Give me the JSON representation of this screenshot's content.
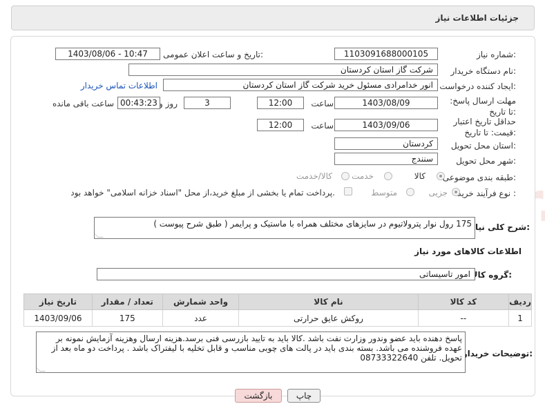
{
  "header": {
    "title": "جزئیات اطلاعات نیاز"
  },
  "form": {
    "need_number": {
      "label": "شماره نیاز:",
      "value": "1103091688000105"
    },
    "announce_datetime": {
      "label": "تاریخ و ساعت اعلان عمومی:",
      "value": "1403/08/06 - 10:47"
    },
    "buyer_org": {
      "label": "نام دستگاه خریدار:",
      "value": "شرکت گاز استان کردستان"
    },
    "requester": {
      "label": "ایجاد کننده درخواست:",
      "value": "انور خدامرادی مسئول خرید  شرکت گاز استان کردستان",
      "contact_link": "اطلاعات تماس خریدار"
    },
    "reply_deadline": {
      "label": "مهلت ارسال پاسخ: تا تاریخ:",
      "date": "1403/08/09",
      "time_label": "ساعت",
      "time": "12:00",
      "days": "3",
      "days_label": "روز و",
      "remaining": "00:43:23",
      "remaining_label": "ساعت باقی مانده"
    },
    "price_validity": {
      "label": "حداقل تاریخ اعتبار قیمت: تا تاریخ:",
      "date": "1403/09/06",
      "time_label": "ساعت",
      "time": "12:00"
    },
    "province": {
      "label": "استان محل تحویل:",
      "value": "کردستان"
    },
    "city": {
      "label": "شهر محل تحویل:",
      "value": "سنندج"
    },
    "category": {
      "label": "طبقه بندی موضوعی:",
      "options": [
        "کالا",
        "خدمت",
        "کالا/خدمت"
      ],
      "selected": "کالا"
    },
    "purchase_process": {
      "label": "نوع فرآیند خرید :",
      "options": [
        "جزیی",
        "متوسط"
      ],
      "selected": "جزیی",
      "note": "پرداخت تمام یا بخشی از مبلغ خرید،از محل \"اسناد خزانه اسلامی\" خواهد بود."
    },
    "description": {
      "label": "شرح کلی نیاز:",
      "value": "175 رول نوار پترولاتیوم در سایزهای مختلف همراه با ماستیک و پرایمر ( طبق شرح پیوست )"
    }
  },
  "goods_section": {
    "title": "اطلاعات کالاهای مورد نیاز",
    "group_label": "گروه کالا:",
    "group_value": "امور تاسیساتی"
  },
  "table": {
    "headers": [
      "ردیف",
      "کد کالا",
      "نام کالا",
      "واحد شمارش",
      "تعداد / مقدار",
      "تاریخ نیاز"
    ],
    "rows": [
      [
        "1",
        "--",
        "روکش عایق حرارتی",
        "عدد",
        "175",
        "1403/09/06"
      ]
    ]
  },
  "buyer_notes": {
    "label": "توضیحات خریدار:",
    "value": "پاسخ دهنده باید عضو وندور وزارت نفت باشد .کالا باید به تایید بازرسی فنی  برسد.هزینه ارسال وهزینه آزمایش نمونه بر عهده فروشنده می باشد. بسته بندی باید در پالت های چوبی مناسب و قابل تخلیه با لیفتراک باشد . پرداخت دو ماه بعد از تحویل. تلفن 08733322640"
  },
  "buttons": {
    "print": "چاپ",
    "back": "بازگشت"
  },
  "watermark": {
    "text": "AriaTender.neT"
  },
  "colors": {
    "link": "#1a55b8",
    "back_button": "#f7d9d9",
    "table_header": "#dcdcdc"
  }
}
